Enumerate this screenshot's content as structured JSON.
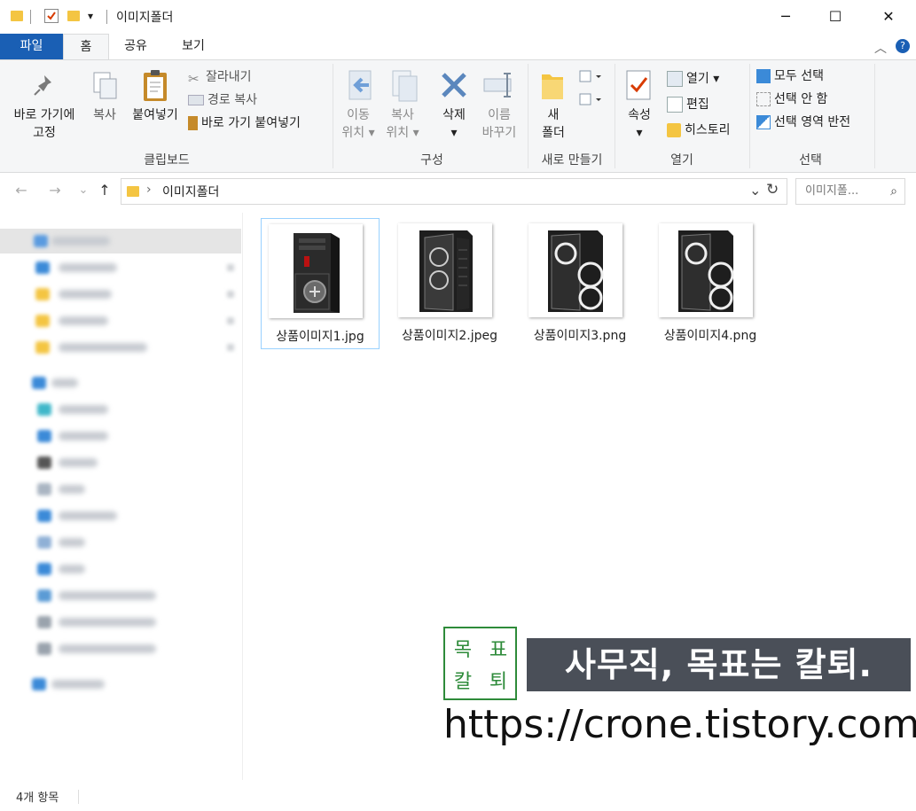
{
  "window": {
    "title": "이미지폴더",
    "minimize": "─",
    "maximize": "☐",
    "close": "✕"
  },
  "tabs": [
    {
      "label": "파일"
    },
    {
      "label": "홈"
    },
    {
      "label": "공유"
    },
    {
      "label": "보기"
    }
  ],
  "ribbon": {
    "clipboard": {
      "label": "클립보드",
      "pin_line1": "바로 가기에",
      "pin_line2": "고정",
      "copy": "복사",
      "paste": "붙여넣기",
      "cut": "잘라내기",
      "copy_path": "경로 복사",
      "paste_shortcut": "바로 가기 붙여넣기"
    },
    "organize": {
      "label": "구성",
      "move_line1": "이동",
      "move_line2": "위치 ▾",
      "copyto_line1": "복사",
      "copyto_line2": "위치 ▾",
      "delete": "삭제",
      "delete_arrow": "▾",
      "rename_line1": "이름",
      "rename_line2": "바꾸기"
    },
    "new": {
      "label": "새로 만들기",
      "folder_line1": "새",
      "folder_line2": "폴더"
    },
    "open": {
      "label": "열기",
      "properties": "속성",
      "properties_arrow": "▾",
      "open": "열기 ▾",
      "edit": "편집",
      "history": "히스토리"
    },
    "select": {
      "label": "선택",
      "all": "모두 선택",
      "none": "선택 안 함",
      "invert": "선택 영역 반전"
    }
  },
  "address": {
    "path": "이미지폴더",
    "search_placeholder": "이미지폴...",
    "back": "←",
    "forward": "→",
    "recent": "⌄",
    "up": "↑",
    "refresh": "↻",
    "dropdown": "⌄",
    "chevron": "›"
  },
  "files": [
    {
      "name": "상품이미지1.jpg",
      "selected": true
    },
    {
      "name": "상품이미지2.jpeg",
      "selected": false
    },
    {
      "name": "상품이미지3.png",
      "selected": false
    },
    {
      "name": "상품이미지4.png",
      "selected": false
    }
  ],
  "status": {
    "count": "4개 항목"
  },
  "watermark": {
    "seal_chars": [
      "목",
      "표",
      "칼",
      "퇴"
    ],
    "tagline": "사무직, 목표는 칼퇴.",
    "url": "https://crone.tistory.com"
  },
  "colors": {
    "accent": "#1a5fb4",
    "folder": "#f4c542",
    "selection_border": "#99d1ff",
    "seal_green": "#2e8b3a"
  }
}
